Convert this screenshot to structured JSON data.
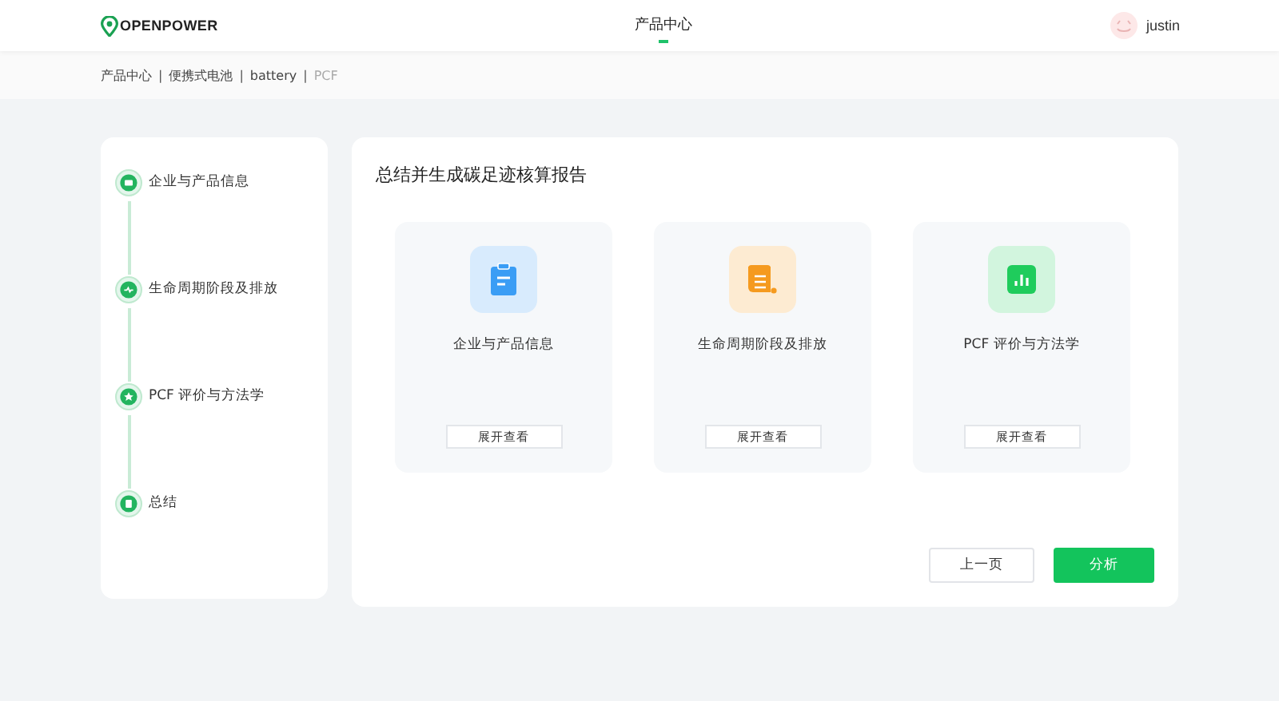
{
  "header": {
    "logo": "OPENPOWER",
    "nav": [
      {
        "label": "产品中心",
        "selected": true
      }
    ],
    "user": "justin"
  },
  "breadcrumb": [
    {
      "label": "产品中心",
      "selected": false
    },
    {
      "separator": "|",
      "label": "便携式电池",
      "selected": false
    },
    {
      "separator": "|",
      "label": "battery",
      "selected": false
    },
    {
      "separator": "|",
      "label": "PCF",
      "selected": true
    }
  ],
  "steps": [
    {
      "label": "企业与产品信息"
    },
    {
      "label": "生命周期阶段及排放"
    },
    {
      "label": "PCF 评价与方法学"
    },
    {
      "label": "总结"
    }
  ],
  "main": {
    "title": "总结并生成碳足迹核算报告",
    "cards": [
      {
        "title": "企业与产品信息",
        "color": "#3a9df5",
        "button": "展开查看"
      },
      {
        "title": "生命周期阶段及排放",
        "color": "#f59a1f",
        "button": "展开查看"
      },
      {
        "title": "PCF 评价与方法学",
        "color": "#1fcc5c",
        "button": "展开查看"
      }
    ],
    "buttons": [
      {
        "label": "上一页",
        "kind": "secondary"
      },
      {
        "label": "分析",
        "kind": "primary"
      }
    ]
  }
}
